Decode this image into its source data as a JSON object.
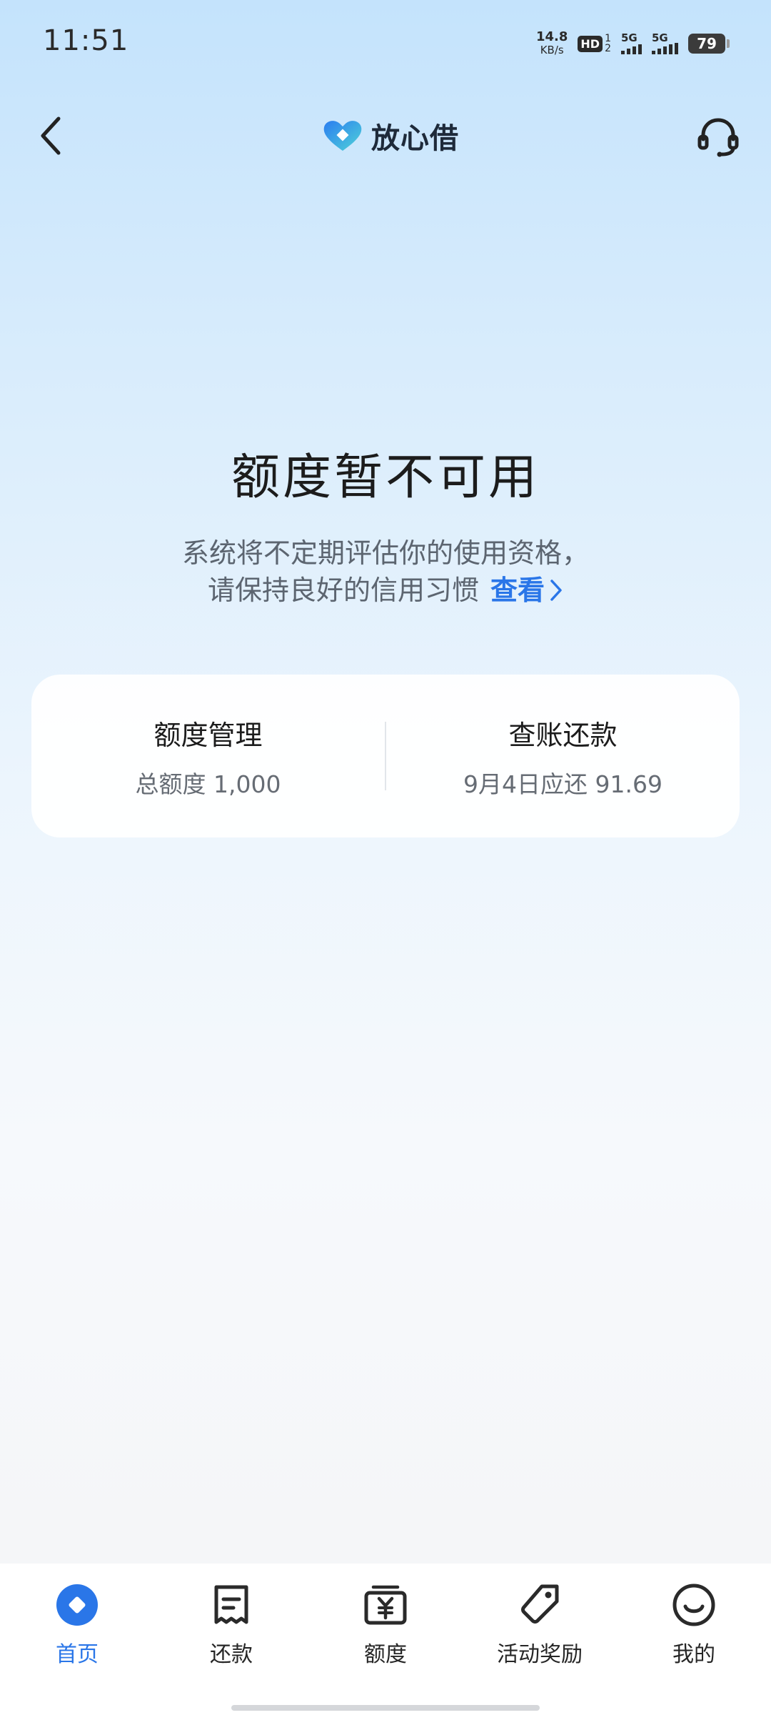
{
  "status_bar": {
    "time": "11:51",
    "net_speed_value": "14.8",
    "net_speed_unit": "KB/s",
    "hd_label": "HD",
    "hd_sim1": "1",
    "hd_sim2": "2",
    "sig1_label": "5G",
    "sig2_label": "5G",
    "battery": "79"
  },
  "header": {
    "brand": "放心借",
    "back_icon": "chevron-left-icon",
    "service_icon": "headset-icon"
  },
  "main": {
    "title": "额度暂不可用",
    "subtitle_line1": "系统将不定期评估你的使用资格，",
    "subtitle_line2": "请保持良好的信用习惯",
    "view_link": "查看"
  },
  "card": {
    "left_title": "额度管理",
    "left_sub": "总额度 1,000",
    "right_title": "查账还款",
    "right_sub": "9月4日应还 91.69"
  },
  "tabs": [
    {
      "label": "首页",
      "icon": "home-diamond-icon",
      "active": true
    },
    {
      "label": "还款",
      "icon": "bill-icon",
      "active": false
    },
    {
      "label": "额度",
      "icon": "yuan-box-icon",
      "active": false
    },
    {
      "label": "活动奖励",
      "icon": "tag-icon",
      "active": false
    },
    {
      "label": "我的",
      "icon": "smile-icon",
      "active": false
    }
  ],
  "colors": {
    "accent": "#2a76e8",
    "text_primary": "#1c1c1c",
    "text_secondary": "#5c6570"
  }
}
